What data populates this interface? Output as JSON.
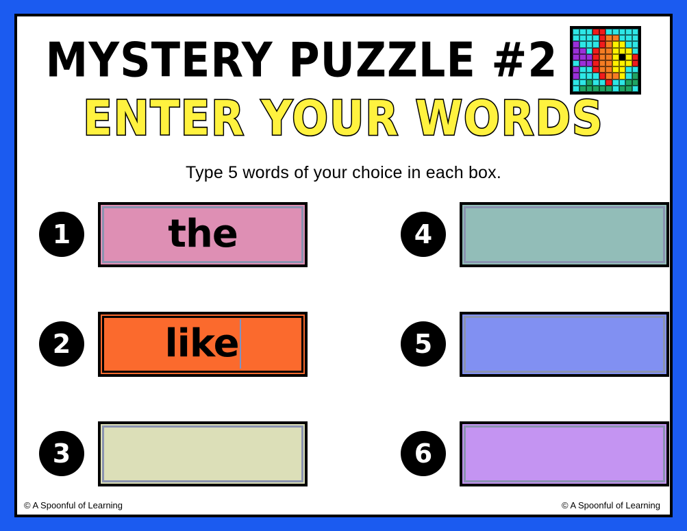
{
  "frame": {
    "border_color": "#1B5BF0",
    "page_background": "#FFFFFF"
  },
  "header": {
    "title": "MYSTERY PUZZLE #2",
    "subtitle": "ENTER YOUR WORDS",
    "subtitle_fill": "#FFF23F",
    "subtitle_outline": "#000000",
    "instruction": "Type 5 words of your choice in each box."
  },
  "thumbnail": {
    "name": "pixel-art-thumbnail",
    "columns": 10,
    "rows": 10,
    "palette": {
      "c": "#2EE6E6",
      "r": "#F01C1C",
      "o": "#F57C23",
      "y": "#FFF200",
      "p": "#9B30D9",
      "g": "#1FA463",
      "k": "#000000"
    },
    "grid": [
      [
        "c",
        "c",
        "c",
        "r",
        "r",
        "c",
        "c",
        "c",
        "c",
        "c"
      ],
      [
        "c",
        "c",
        "c",
        "c",
        "r",
        "o",
        "o",
        "c",
        "c",
        "c"
      ],
      [
        "p",
        "c",
        "c",
        "c",
        "r",
        "o",
        "y",
        "y",
        "c",
        "c"
      ],
      [
        "p",
        "p",
        "c",
        "r",
        "o",
        "o",
        "y",
        "y",
        "y",
        "c"
      ],
      [
        "p",
        "p",
        "p",
        "r",
        "o",
        "o",
        "y",
        "k",
        "y",
        "r"
      ],
      [
        "c",
        "p",
        "p",
        "r",
        "o",
        "o",
        "y",
        "y",
        "y",
        "r"
      ],
      [
        "p",
        "c",
        "c",
        "r",
        "o",
        "o",
        "y",
        "y",
        "c",
        "c"
      ],
      [
        "p",
        "c",
        "c",
        "c",
        "r",
        "o",
        "o",
        "y",
        "c",
        "g"
      ],
      [
        "c",
        "c",
        "g",
        "c",
        "c",
        "r",
        "c",
        "c",
        "g",
        "g"
      ],
      [
        "c",
        "g",
        "g",
        "g",
        "g",
        "g",
        "c",
        "g",
        "g",
        "c"
      ]
    ]
  },
  "boxes": [
    {
      "number": "1",
      "word": "the",
      "fill": "#DE8FB4",
      "border": "#8A93B0",
      "has_caret": false,
      "column": "left"
    },
    {
      "number": "2",
      "word": "like",
      "fill": "#FB6A2D",
      "border": "#000000",
      "has_caret": true,
      "column": "left"
    },
    {
      "number": "3",
      "word": "",
      "fill": "#DCDFB8",
      "border": "#8A93B0",
      "has_caret": false,
      "column": "left"
    },
    {
      "number": "4",
      "word": "",
      "fill": "#92BDB8",
      "border": "#8A93B0",
      "has_caret": false,
      "column": "right"
    },
    {
      "number": "5",
      "word": "",
      "fill": "#8190F2",
      "border": "#8A93B0",
      "has_caret": false,
      "column": "right"
    },
    {
      "number": "6",
      "word": "",
      "fill": "#C494F2",
      "border": "#8A93B0",
      "has_caret": false,
      "column": "right"
    }
  ],
  "footer": {
    "left_credit": "© A Spoonful of Learning",
    "right_credit": "© A Spoonful of Learning"
  }
}
